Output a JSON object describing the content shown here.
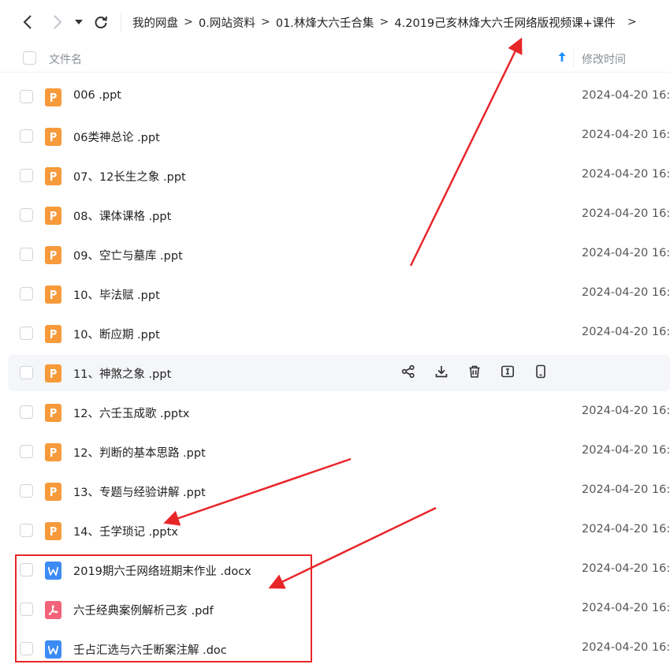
{
  "nav": {
    "back_icon": "chevron-left-icon",
    "forward_icon": "chevron-right-icon",
    "history_icon": "caret-down-icon",
    "refresh_icon": "refresh-icon"
  },
  "breadcrumb": [
    {
      "label": "我的网盘"
    },
    {
      "label": "0.网站资料"
    },
    {
      "label": "01.林烽大六壬合集"
    },
    {
      "label": "4.2019己亥林烽大六壬网络版视频课+课件"
    }
  ],
  "table": {
    "col_name": "文件名",
    "col_mtime": "修改时间",
    "sort_icon": "arrow-up-icon"
  },
  "files": [
    {
      "name": "006 .ppt",
      "type": "ppt",
      "mtime": "2024-04-20 16:"
    },
    {
      "name": "06类神总论 .ppt",
      "type": "ppt",
      "mtime": "2024-04-20 16:"
    },
    {
      "name": "07、12长生之象 .ppt",
      "type": "ppt",
      "mtime": "2024-04-20 16:"
    },
    {
      "name": "08、课体课格 .ppt",
      "type": "ppt",
      "mtime": "2024-04-20 16:"
    },
    {
      "name": "09、空亡与墓库 .ppt",
      "type": "ppt",
      "mtime": "2024-04-20 16:"
    },
    {
      "name": "10、毕法赋 .ppt",
      "type": "ppt",
      "mtime": "2024-04-20 16:"
    },
    {
      "name": "10、断应期 .ppt",
      "type": "ppt",
      "mtime": "2024-04-20 16:"
    },
    {
      "name": "11、神煞之象 .ppt",
      "type": "ppt",
      "mtime": "",
      "hover": true
    },
    {
      "name": "12、六壬玉成歌 .pptx",
      "type": "ppt",
      "mtime": "2024-04-20 16:"
    },
    {
      "name": "12、判断的基本思路 .ppt",
      "type": "ppt",
      "mtime": "2024-04-20 16:"
    },
    {
      "name": "13、专题与经验讲解 .ppt",
      "type": "ppt",
      "mtime": "2024-04-20 16:"
    },
    {
      "name": "14、壬学琐记 .pptx",
      "type": "ppt",
      "mtime": "2024-04-20 16:"
    },
    {
      "name": "2019期六壬网络班期末作业 .docx",
      "type": "doc",
      "mtime": "2024-04-20 16:"
    },
    {
      "name": "六壬经典案例解析己亥 .pdf",
      "type": "pdf",
      "mtime": "2024-04-20 16:"
    },
    {
      "name": "壬占汇选与六壬断案注解 .doc",
      "type": "doc",
      "mtime": "2024-04-20 16:"
    }
  ],
  "row_actions": [
    {
      "icon": "share-icon"
    },
    {
      "icon": "download-icon"
    },
    {
      "icon": "delete-icon"
    },
    {
      "icon": "rename-icon"
    },
    {
      "icon": "mobile-icon"
    }
  ],
  "colors": {
    "ppt": "#f79a3b",
    "doc": "#3d8bf5",
    "pdf": "#f2637a",
    "accent": "#1a8cff",
    "annotation": "#e8262a"
  }
}
